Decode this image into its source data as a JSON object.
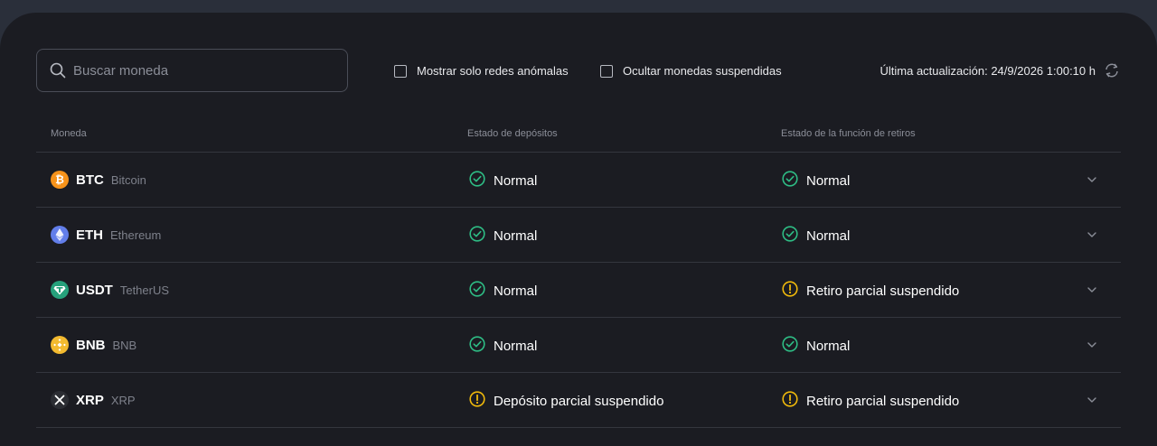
{
  "search": {
    "placeholder": "Buscar moneda"
  },
  "filters": {
    "anomalous_label": "Mostrar solo redes anómalas",
    "hide_suspended_label": "Ocultar monedas suspendidas"
  },
  "last_update": "Última actualización: 24/9/2026 1:00:10 h",
  "table": {
    "headers": [
      "Moneda",
      "Estado de depósitos",
      "Estado de la función de retiros"
    ],
    "rows": [
      {
        "symbol": "BTC",
        "name": "Bitcoin",
        "icon": "bitcoin-icon",
        "icon_color": "#f7931a",
        "deposit": "Normal",
        "deposit_state": "ok",
        "withdraw": "Normal",
        "withdraw_state": "ok"
      },
      {
        "symbol": "ETH",
        "name": "Ethereum",
        "icon": "ethereum-icon",
        "icon_color": "#627eea",
        "deposit": "Normal",
        "deposit_state": "ok",
        "withdraw": "Normal",
        "withdraw_state": "ok"
      },
      {
        "symbol": "USDT",
        "name": "TetherUS",
        "icon": "tether-icon",
        "icon_color": "#26a17b",
        "deposit": "Normal",
        "deposit_state": "ok",
        "withdraw": "Retiro parcial suspendido",
        "withdraw_state": "warning"
      },
      {
        "symbol": "BNB",
        "name": "BNB",
        "icon": "bnb-icon",
        "icon_color": "#f3ba2f",
        "deposit": "Normal",
        "deposit_state": "ok",
        "withdraw": "Normal",
        "withdraw_state": "ok"
      },
      {
        "symbol": "XRP",
        "name": "XRP",
        "icon": "xrp-icon",
        "icon_color": "#2b2d33",
        "deposit": "Depósito parcial suspendido",
        "deposit_state": "warning",
        "withdraw": "Retiro parcial suspendido",
        "withdraw_state": "warning"
      }
    ]
  },
  "colors": {
    "ok": "#2ebd85",
    "warning": "#f0b90b",
    "background": "#1b1c22"
  }
}
